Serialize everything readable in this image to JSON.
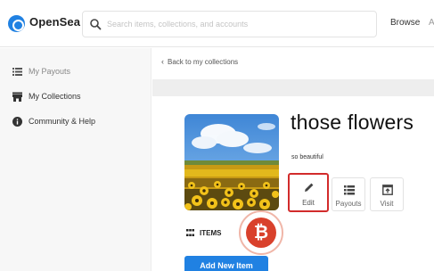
{
  "header": {
    "brand": "OpenSea",
    "search_placeholder": "Search items, collections, and accounts",
    "browse_label": "Browse",
    "more_nav_label": "A"
  },
  "sidebar": {
    "items": [
      {
        "label": "My Payouts",
        "icon": "list-icon"
      },
      {
        "label": "My Collections",
        "icon": "storefront-icon"
      },
      {
        "label": "Community & Help",
        "icon": "info-icon"
      }
    ]
  },
  "main": {
    "back_label": "Back to my collections",
    "collection_title": "those flowers",
    "collection_description": "so beautiful",
    "actions": [
      {
        "label": "Edit",
        "icon": "pencil-icon"
      },
      {
        "label": "Payouts",
        "icon": "list-icon"
      },
      {
        "label": "Visit",
        "icon": "external-icon"
      }
    ],
    "items_label": "ITEMS",
    "add_new_item_label": "Add New Item"
  },
  "watermark": {
    "symbol": "₿"
  },
  "colors": {
    "accent": "#2081e2",
    "edit_highlight": "#d22b2b",
    "watermark": "#d9412c"
  }
}
